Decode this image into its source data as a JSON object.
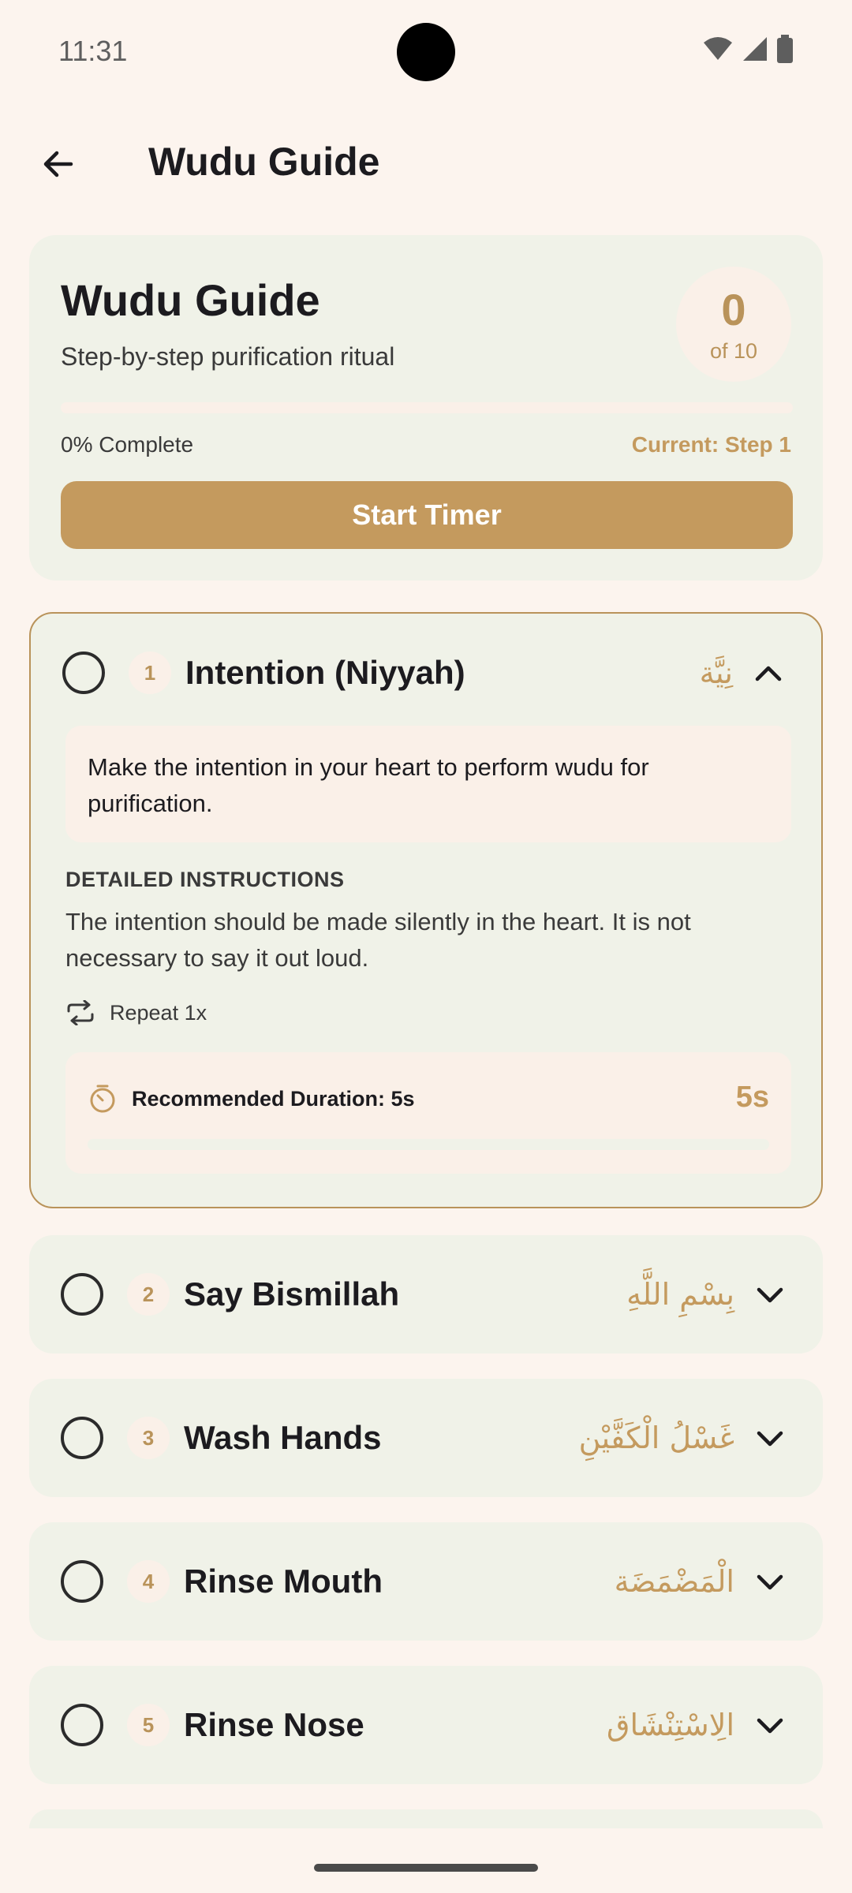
{
  "status_bar": {
    "time": "11:31"
  },
  "app_bar": {
    "title": "Wudu Guide"
  },
  "summary": {
    "title": "Wudu Guide",
    "subtitle": "Step-by-step purification ritual",
    "completed_count": "0",
    "total_label": "of 10",
    "progress_fraction": 0,
    "percent_label": "0% Complete",
    "current_step_label": "Current: Step  1",
    "start_button_label": "Start Timer"
  },
  "steps": [
    {
      "number": "1",
      "title": "Intention (Niyyah)",
      "arabic": "نِيَّة",
      "expanded": true,
      "description": "Make the intention in your heart to perform wudu for purification.",
      "detail_heading": "DETAILED INSTRUCTIONS",
      "detail_text": "The intention should be made silently in the heart. It is not necessary to say it out loud.",
      "repeat_label": "Repeat 1x",
      "duration_label": "Recommended Duration:  5s",
      "duration_value": "5s",
      "duration_progress": 0
    },
    {
      "number": "2",
      "title": "Say Bismillah",
      "arabic": "بِسْمِ اللَّهِ",
      "expanded": false
    },
    {
      "number": "3",
      "title": "Wash Hands",
      "arabic": "غَسْلُ الْكَفَّيْنِ",
      "expanded": false
    },
    {
      "number": "4",
      "title": "Rinse Mouth",
      "arabic": "الْمَضْمَضَة",
      "expanded": false
    },
    {
      "number": "5",
      "title": "Rinse Nose",
      "arabic": "الِاسْتِنْشَاق",
      "expanded": false
    }
  ],
  "colors": {
    "accent": "#C49A5E",
    "card_background": "#F0F2E8",
    "page_background": "#FCF4EE",
    "inner_box": "#FAF0E8"
  }
}
